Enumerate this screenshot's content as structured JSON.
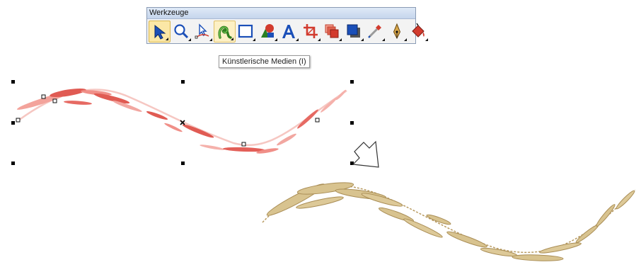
{
  "toolbar": {
    "title": "Werkzeuge",
    "tools": [
      {
        "name": "pick-tool",
        "icon": "arrow-pointer-icon",
        "state": "active"
      },
      {
        "name": "zoom-tool",
        "icon": "magnifier-icon"
      },
      {
        "name": "shape-tool",
        "icon": "node-pointer-icon"
      },
      {
        "name": "artistic-media-tool",
        "icon": "artistic-media-icon",
        "state": "hover"
      },
      {
        "name": "rectangle-tool",
        "icon": "rectangle-icon"
      },
      {
        "name": "basic-shapes-tool",
        "icon": "basic-shapes-icon"
      },
      {
        "name": "text-tool",
        "icon": "text-a-icon"
      },
      {
        "name": "crop-tool",
        "icon": "crop-icon"
      },
      {
        "name": "interactive-blend-tool",
        "icon": "blend-icon"
      },
      {
        "name": "shadow-tool",
        "icon": "drop-shadow-icon"
      },
      {
        "name": "eyedropper-tool",
        "icon": "eyedropper-icon"
      },
      {
        "name": "outline-pen-tool",
        "icon": "pen-nib-icon"
      },
      {
        "name": "fill-tool",
        "icon": "paint-bucket-icon"
      }
    ]
  },
  "tooltip": "Künstlerische Medien (I)",
  "colors": {
    "selection_stroke": "#f2b6b0",
    "selection_stroke_dark": "#e2675f",
    "embroidery_thread": "#d8c38f",
    "embroidery_thread_dark": "#a98d55",
    "active_tool_bg": "#fbe7a6"
  }
}
